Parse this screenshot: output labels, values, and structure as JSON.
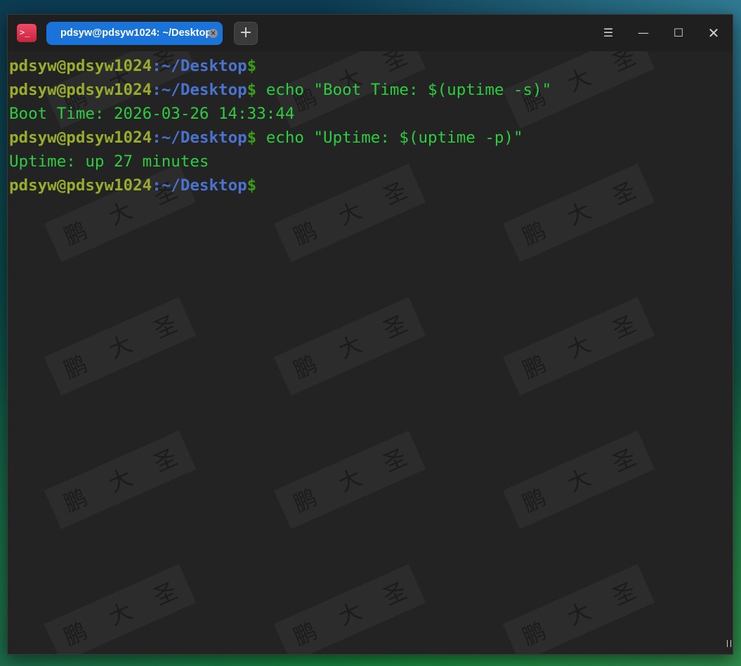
{
  "tab": {
    "title": "pdsyw@pdsyw1024: ~/Desktop",
    "close_glyph": "×"
  },
  "titlebar": {
    "app_icon_glyph": ">_",
    "new_tab_glyph": "+",
    "menu_glyph": "☰",
    "minimize_glyph": "—",
    "maximize_glyph": "☐",
    "close_glyph": "✕"
  },
  "terminal": {
    "lines": [
      {
        "user": "pdsyw@pdsyw1024",
        "sep": ":",
        "path": "~/Desktop",
        "dollar": "$",
        "cmd": ""
      },
      {
        "user": "pdsyw@pdsyw1024",
        "sep": ":",
        "path": "~/Desktop",
        "dollar": "$",
        "cmd": " echo \"Boot Time: $(uptime -s)\""
      },
      {
        "output": "Boot Time: 2026-03-26 14:33:44"
      },
      {
        "user": "pdsyw@pdsyw1024",
        "sep": ":",
        "path": "~/Desktop",
        "dollar": "$",
        "cmd": " echo \"Uptime: $(uptime -p)\""
      },
      {
        "output": "Uptime: up 27 minutes"
      },
      {
        "user": "pdsyw@pdsyw1024",
        "sep": ":",
        "path": "~/Desktop",
        "dollar": "$",
        "cmd": ""
      }
    ]
  },
  "watermark": {
    "chars": [
      "鹏",
      "大",
      "圣"
    ]
  },
  "colors": {
    "prompt_user": "#9aac2c",
    "prompt_path": "#4a73d0",
    "prompt_dollar": "#3b9d1a",
    "command_text": "#2ecc40",
    "tab_active": "#1a73d9",
    "background": "#232323"
  },
  "icons": {
    "app": "terminal-app-icon",
    "tab_close": "close-icon",
    "new_tab": "plus-icon",
    "menu": "hamburger-menu-icon",
    "minimize": "minimize-icon",
    "maximize": "maximize-icon",
    "close": "close-icon"
  }
}
